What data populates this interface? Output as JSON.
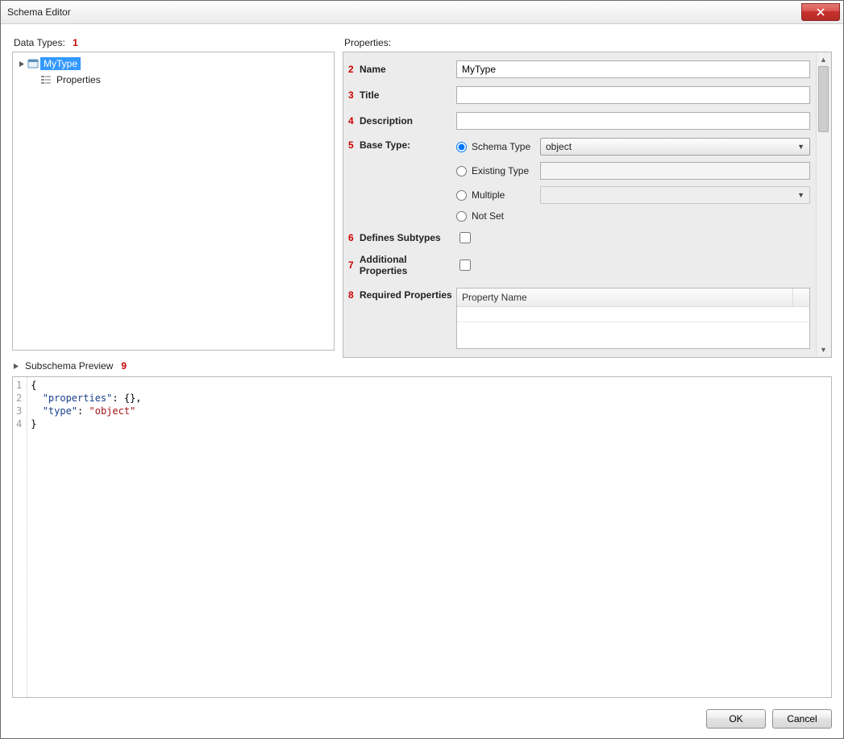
{
  "window": {
    "title": "Schema Editor"
  },
  "annotations": {
    "n1": "1",
    "n2": "2",
    "n3": "3",
    "n4": "4",
    "n5": "5",
    "n6": "6",
    "n7": "7",
    "n8": "8",
    "n9": "9"
  },
  "left": {
    "heading": "Data Types:",
    "tree": {
      "root": {
        "label": "MyType"
      },
      "child": {
        "label": "Properties"
      }
    }
  },
  "right": {
    "heading": "Properties:",
    "fields": {
      "name": {
        "label": "Name",
        "value": "MyType"
      },
      "title": {
        "label": "Title",
        "value": ""
      },
      "description": {
        "label": "Description",
        "value": ""
      },
      "base_type": {
        "label": "Base Type:",
        "options": {
          "schema_type": {
            "label": "Schema Type",
            "selected": true,
            "value": "object"
          },
          "existing_type": {
            "label": "Existing Type",
            "selected": false,
            "value": ""
          },
          "multiple": {
            "label": "Multiple",
            "selected": false,
            "value": ""
          },
          "not_set": {
            "label": "Not Set",
            "selected": false
          }
        }
      },
      "defines_subtypes": {
        "label": "Defines Subtypes",
        "checked": false
      },
      "additional_properties": {
        "label": "Additional Properties",
        "checked": false
      },
      "required_properties": {
        "label": "Required Properties",
        "column_header": "Property Name",
        "rows": []
      }
    }
  },
  "preview": {
    "heading": "Subschema Preview",
    "lines": [
      {
        "n": 1,
        "tokens": [
          {
            "t": "{",
            "c": "punc"
          }
        ]
      },
      {
        "n": 2,
        "tokens": [
          {
            "t": "  ",
            "c": "punc"
          },
          {
            "t": "\"properties\"",
            "c": "key"
          },
          {
            "t": ": {},",
            "c": "punc"
          }
        ]
      },
      {
        "n": 3,
        "tokens": [
          {
            "t": "  ",
            "c": "punc"
          },
          {
            "t": "\"type\"",
            "c": "key"
          },
          {
            "t": ": ",
            "c": "punc"
          },
          {
            "t": "\"object\"",
            "c": "str"
          }
        ]
      },
      {
        "n": 4,
        "tokens": [
          {
            "t": "}",
            "c": "punc"
          }
        ]
      }
    ]
  },
  "footer": {
    "ok": "OK",
    "cancel": "Cancel"
  }
}
